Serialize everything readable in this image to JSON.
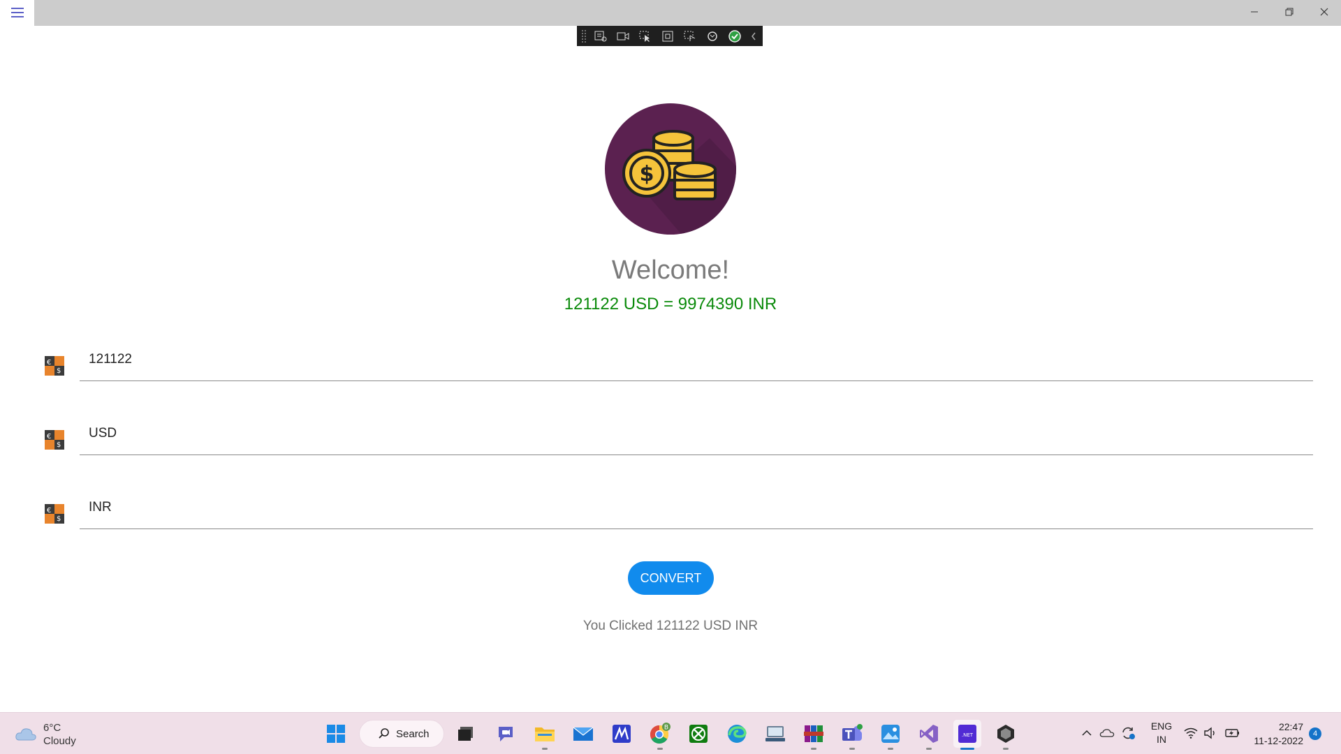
{
  "window": {
    "buttons": [
      "minimize",
      "restore",
      "close"
    ]
  },
  "main": {
    "welcome": "Welcome!",
    "result": "121122 USD = 9974390 INR",
    "amount_value": "121122",
    "from_value": "USD",
    "to_value": "INR",
    "convert_label": "CONVERT",
    "clicked_text": "You Clicked 121122 USD INR",
    "accent_color": "#118bed",
    "result_color": "#0a8a0a",
    "logo_bg": "#5b2150"
  },
  "taskbar": {
    "weather_temp": "6°C",
    "weather_desc": "Cloudy",
    "search_label": "Search",
    "lang_top": "ENG",
    "lang_bottom": "IN",
    "time": "22:47",
    "date": "11-12-2022",
    "notifications": "4",
    "chrome_badge": "B",
    "dotnet_label": ".NET"
  },
  "icons": [
    "hamburger-icon",
    "start-icon",
    "task-view-icon",
    "chat-icon",
    "file-explorer-icon",
    "mail-icon",
    "edit-app-icon",
    "chrome-icon",
    "xbox-icon",
    "edge-icon",
    "network-tool-icon",
    "winrar-icon",
    "teams-icon",
    "photos-icon",
    "visual-studio-icon",
    "dotnet-app-icon",
    "unity-icon"
  ]
}
